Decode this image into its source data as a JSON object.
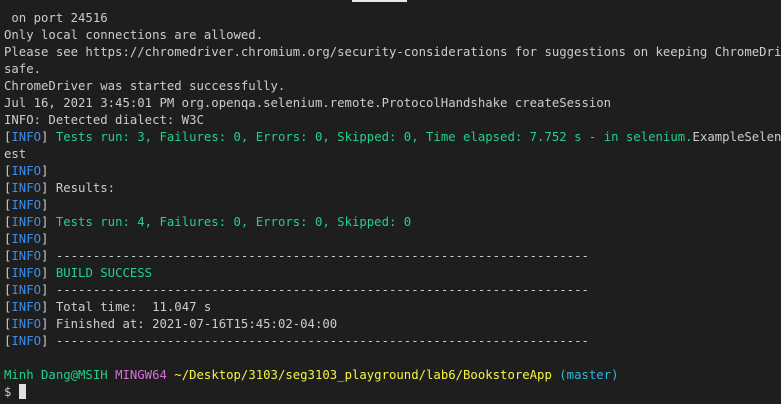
{
  "terminal": {
    "log_lines": [
      " on port 24516",
      "Only local connections are allowed.",
      "Please see https://chromedriver.chromium.org/security-considerations for suggestions on keeping ChromeDriver",
      "safe.",
      "ChromeDriver was started successfully.",
      "Jul 16, 2021 3:45:01 PM org.openqa.selenium.remote.ProtocolHandshake createSession",
      "INFO: Detected dialect: W3C"
    ],
    "tests_run_1": "Tests run: 3, Failures: 0, Errors: 0, Skipped: 0, Time elapsed: 7.752 s - in selenium.",
    "tests_run_1_class": "ExampleSeleniumT",
    "tests_run_1_wrap": "est",
    "info_tag": "INFO",
    "bracket_open": "[",
    "bracket_close": "]",
    "results_label": " Results:",
    "tests_run_2": " Tests run: 4, Failures: 0, Errors: 0, Skipped: 0",
    "dashes": " ------------------------------------------------------------------------",
    "build_success": " BUILD SUCCESS",
    "total_time": " Total time:  11.047 s",
    "finished_at": " Finished at: 2021-07-16T15:45:02-04:00"
  },
  "prompt": {
    "user_host": "Minh Dang@MSIH",
    "msystem": "MINGW64",
    "cwd": "~/Desktop/3103/seg3103_playground/lab6/BookstoreApp",
    "branch": "(master)",
    "symbol": "$"
  },
  "colors": {
    "background": "#1e1e1e",
    "text": "#cccccc",
    "info": "#3b8eea",
    "success": "#23d18b",
    "msystem": "#d670d6",
    "path": "#f5f543",
    "branch": "#29b8db"
  }
}
